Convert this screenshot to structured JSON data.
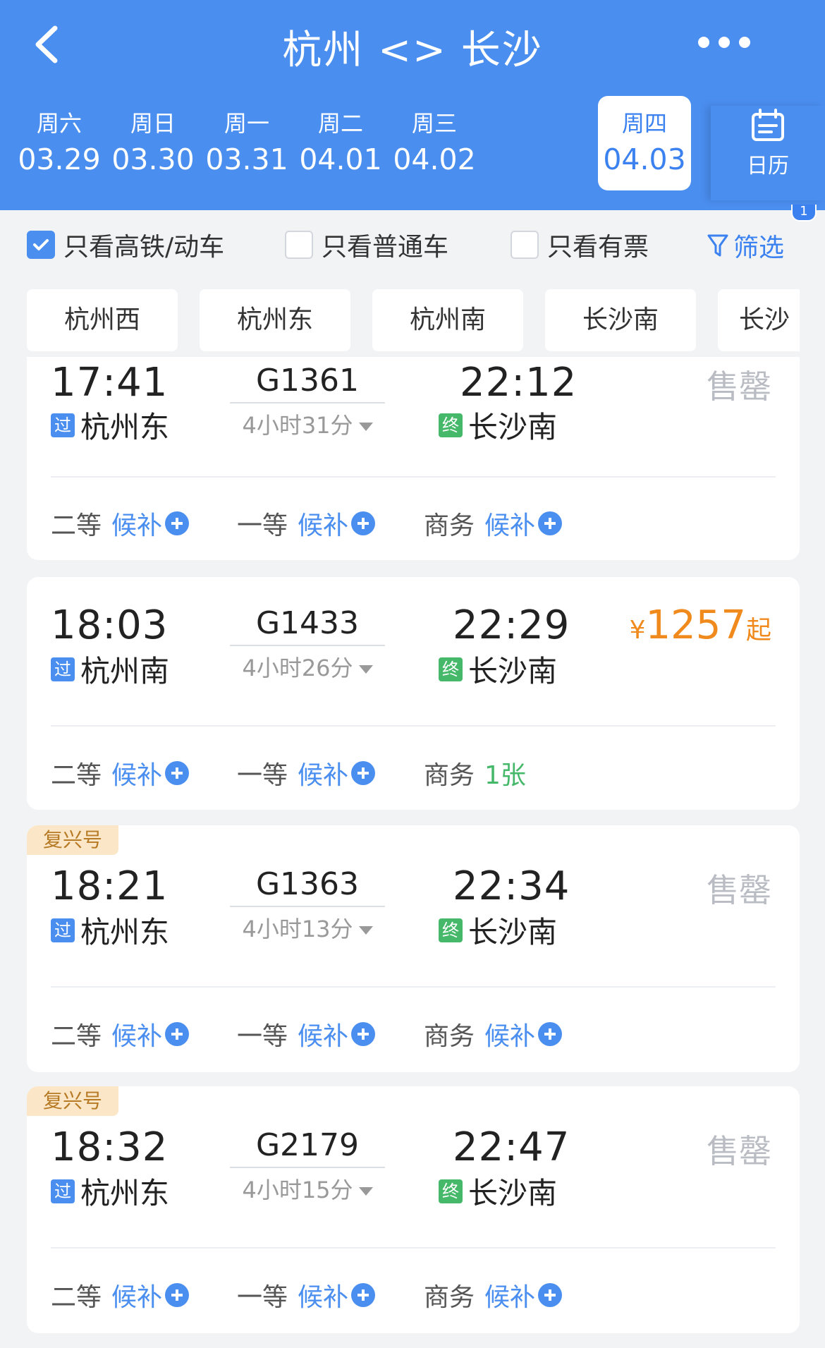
{
  "header": {
    "title": "杭州 <> 长沙",
    "dates": [
      {
        "weekday": "周六",
        "date": "03.29"
      },
      {
        "weekday": "周日",
        "date": "03.30"
      },
      {
        "weekday": "周一",
        "date": "03.31"
      },
      {
        "weekday": "周二",
        "date": "04.01"
      },
      {
        "weekday": "周三",
        "date": "04.02"
      },
      {
        "weekday": "周四",
        "date": "04.03",
        "selected": true
      }
    ],
    "calendar_label": "日历",
    "calendar_badge": "1"
  },
  "filters": {
    "high_speed": {
      "label": "只看高铁/动车",
      "checked": true
    },
    "normal": {
      "label": "只看普通车",
      "checked": false
    },
    "available": {
      "label": "只看有票",
      "checked": false
    },
    "filter_label": "筛选"
  },
  "stations": [
    "杭州西",
    "杭州东",
    "杭州南",
    "长沙南",
    "长沙"
  ],
  "trains": [
    {
      "tag": "",
      "dep_time": "17:41",
      "train_no": "G1361",
      "duration": "4小时31分",
      "arr_time": "22:12",
      "dep_badge": "过",
      "dep_station": "杭州东",
      "arr_badge": "终",
      "arr_station": "长沙南",
      "status": "售罄",
      "seats": [
        {
          "cls": "二等",
          "value": "候补"
        },
        {
          "cls": "一等",
          "value": "候补"
        },
        {
          "cls": "商务",
          "value": "候补"
        }
      ]
    },
    {
      "tag": "",
      "dep_time": "18:03",
      "train_no": "G1433",
      "duration": "4小时26分",
      "arr_time": "22:29",
      "dep_badge": "过",
      "dep_station": "杭州南",
      "arr_badge": "终",
      "arr_station": "长沙南",
      "price_yen": "¥",
      "price": "1257",
      "price_suffix": "起",
      "seats": [
        {
          "cls": "二等",
          "value": "候补"
        },
        {
          "cls": "一等",
          "value": "候补"
        },
        {
          "cls": "商务",
          "value": "1张"
        }
      ]
    },
    {
      "tag": "复兴号",
      "dep_time": "18:21",
      "train_no": "G1363",
      "duration": "4小时13分",
      "arr_time": "22:34",
      "dep_badge": "过",
      "dep_station": "杭州东",
      "arr_badge": "终",
      "arr_station": "长沙南",
      "status": "售罄",
      "seats": [
        {
          "cls": "二等",
          "value": "候补"
        },
        {
          "cls": "一等",
          "value": "候补"
        },
        {
          "cls": "商务",
          "value": "候补"
        }
      ]
    },
    {
      "tag": "复兴号",
      "dep_time": "18:32",
      "train_no": "G2179",
      "duration": "4小时15分",
      "arr_time": "22:47",
      "dep_badge": "过",
      "dep_station": "杭州东",
      "arr_badge": "终",
      "arr_station": "长沙南",
      "status": "售罄",
      "seats": [
        {
          "cls": "二等",
          "value": "候补"
        },
        {
          "cls": "一等",
          "value": "候补"
        },
        {
          "cls": "商务",
          "value": "候补"
        }
      ]
    }
  ],
  "colors": {
    "accent": "#4a8ef0",
    "price": "#f08a1c",
    "available": "#45b86a",
    "sold_out": "#b9bcc3",
    "tag_bg": "#fbe7c8"
  }
}
